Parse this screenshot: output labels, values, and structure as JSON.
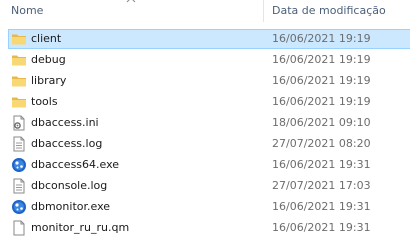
{
  "columns": {
    "name": "Nome",
    "date": "Data de modificação"
  },
  "rows": [
    {
      "name": "client",
      "date": "16/06/2021 19:19",
      "icon": "folder-icon",
      "selected": true
    },
    {
      "name": "debug",
      "date": "16/06/2021 19:19",
      "icon": "folder-icon"
    },
    {
      "name": "library",
      "date": "16/06/2021 19:19",
      "icon": "folder-icon"
    },
    {
      "name": "tools",
      "date": "16/06/2021 19:19",
      "icon": "folder-icon"
    },
    {
      "name": "dbaccess.ini",
      "date": "18/06/2021 09:10",
      "icon": "ini-settings-file-icon"
    },
    {
      "name": "dbaccess.log",
      "date": "27/07/2021 08:20",
      "icon": "text-file-icon"
    },
    {
      "name": "dbaccess64.exe",
      "date": "16/06/2021 19:31",
      "icon": "application-exe-icon"
    },
    {
      "name": "dbconsole.log",
      "date": "27/07/2021 17:03",
      "icon": "text-file-icon"
    },
    {
      "name": "dbmonitor.exe",
      "date": "16/06/2021 19:31",
      "icon": "application-exe-icon"
    },
    {
      "name": "monitor_ru_ru.qm",
      "date": "16/06/2021 19:31",
      "icon": "blank-file-icon"
    }
  ],
  "colors": {
    "selection": "#cce8ff",
    "selection_border": "#99d1ff",
    "header_text": "#4c607a",
    "folder": "#f8d775"
  }
}
